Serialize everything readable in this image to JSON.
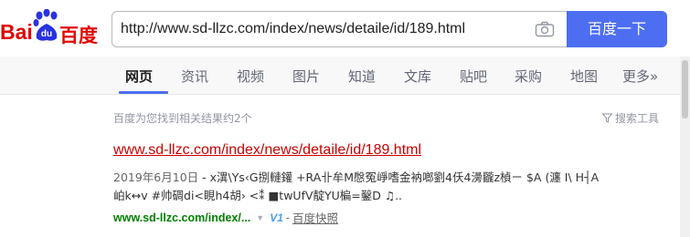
{
  "logo": {
    "left_text": "Bai",
    "paw_text": "du",
    "right_text": "百度"
  },
  "search": {
    "query": "http://www.sd-llzc.com/index/news/detaile/id/189.html",
    "button_label": "百度一下"
  },
  "tabs": [
    "网页",
    "资讯",
    "视频",
    "图片",
    "知道",
    "文库",
    "贴吧",
    "采购",
    "地图",
    "更多»"
  ],
  "results_meta": {
    "count_text": "百度为您找到相关结果约2个",
    "tools_label": "搜索工具"
  },
  "result": {
    "title": "www.sd-llzc.com/index/news/detaile/id/189.html",
    "date": "2019年6月10日",
    "abstract_line1": " - x潩\\Ys‹G捌轋鑵 +RA卝牟M慇冤崢嗜金衲啷劉4仸4澷龖z楨ㄧ $A (瀍 I\\ H┤A",
    "abstract_line2": "岶k↔v #帅碉di<睍h4胡› <⁑ ■twUfV靛YU楄=鑿D ♫..",
    "url": "www.sd-llzc.com/index/...",
    "badge": "V1",
    "separator": "-",
    "snapshot_label": "百度快照"
  },
  "colors": {
    "brand_blue": "#4e6ef2",
    "title_red": "#cc0000",
    "url_green": "#008000",
    "logo_red": "#e10602"
  }
}
